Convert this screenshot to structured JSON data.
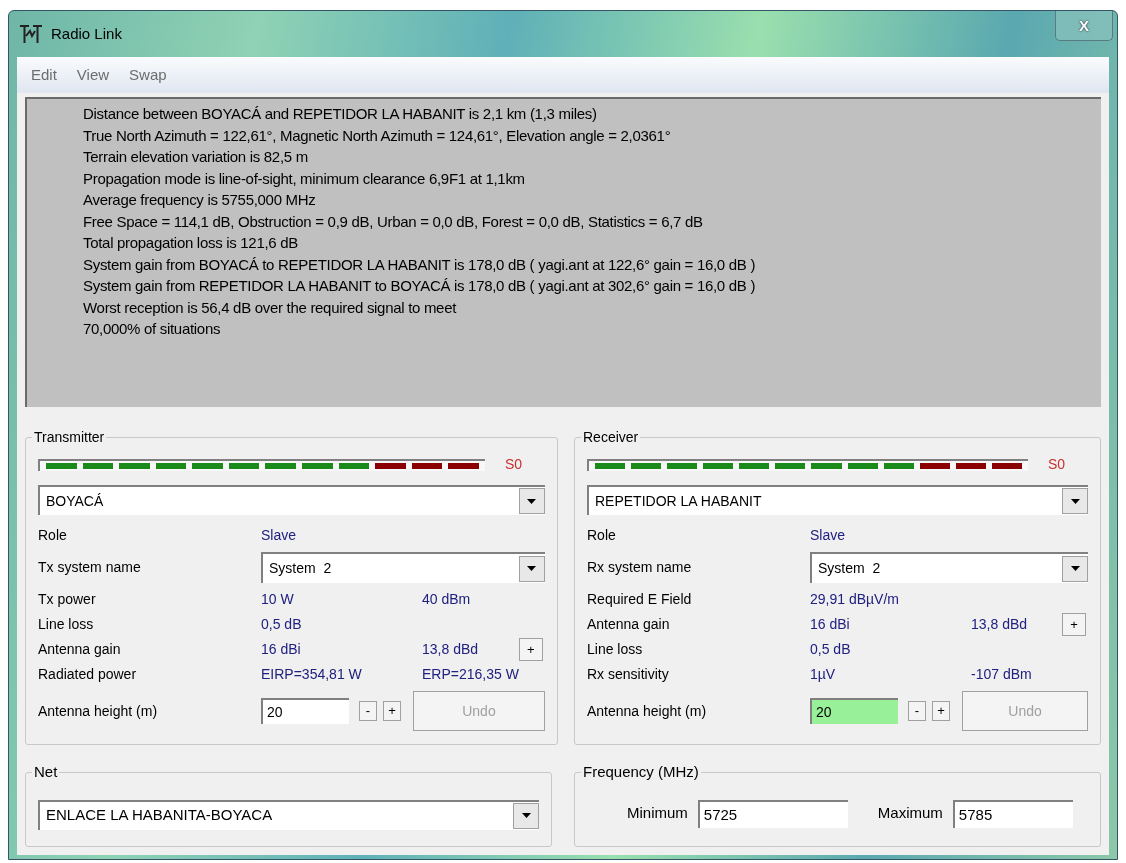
{
  "window": {
    "title": "Radio Link",
    "close": "X"
  },
  "menu": [
    {
      "label": "Edit"
    },
    {
      "label": "View"
    },
    {
      "label": "Swap"
    }
  ],
  "report": [
    "Distance between BOYACÁ and REPETIDOR LA HABANIT is 2,1 km (1,3 miles)",
    "True North Azimuth = 122,61°, Magnetic North Azimuth = 124,61°, Elevation angle = 2,0361°",
    "Terrain elevation variation is 82,5 m",
    "Propagation mode is line-of-sight, minimum clearance 6,9F1 at 1,1km",
    "Average frequency is 5755,000 MHz",
    "Free Space = 114,1 dB, Obstruction = 0,9 dB, Urban = 0,0 dB, Forest = 0,0 dB, Statistics = 6,7 dB",
    "Total propagation loss is 121,6 dB",
    "System gain from BOYACÁ to REPETIDOR LA HABANIT is 178,0 dB ( yagi.ant at 122,6° gain = 16,0 dB )",
    "System gain from REPETIDOR LA HABANIT to BOYACÁ is 178,0 dB ( yagi.ant at 302,6° gain = 16,0 dB )",
    "Worst reception is 56,4 dB over the required signal to meet",
    "70,000% of situations"
  ],
  "stations": [
    {
      "title": "Transmitter",
      "meter_label": "S0",
      "site": "BOYACÁ",
      "rows": [
        {
          "kind": "text",
          "label": "Role",
          "values": [
            "Slave"
          ]
        },
        {
          "kind": "select",
          "label": "Tx system name",
          "value": "System  2"
        },
        {
          "kind": "text",
          "label": "Tx power",
          "values": [
            "10 W",
            "40 dBm"
          ]
        },
        {
          "kind": "text",
          "label": "Line loss",
          "values": [
            "0,5 dB"
          ]
        },
        {
          "kind": "text",
          "label": "Antenna gain",
          "values": [
            "16 dBi",
            "13,8 dBd"
          ],
          "button": "+"
        },
        {
          "kind": "text",
          "label": "Radiated power",
          "values": [
            "EIRP=354,81 W",
            "ERP=216,35 W"
          ]
        }
      ],
      "height": {
        "label": "Antenna height (m)",
        "value": "20",
        "highlighted": false,
        "minus": "-",
        "plus": "+",
        "undo": "Undo",
        "undo_disabled": true
      }
    },
    {
      "title": "Receiver",
      "meter_label": "S0",
      "site": "REPETIDOR LA HABANIT",
      "rows": [
        {
          "kind": "text",
          "label": "Role",
          "values": [
            "Slave"
          ]
        },
        {
          "kind": "select",
          "label": "Rx system name",
          "value": "System  2"
        },
        {
          "kind": "text",
          "label": "Required E Field",
          "values": [
            "29,91 dBµV/m"
          ]
        },
        {
          "kind": "text",
          "label": "Antenna gain",
          "values": [
            "16 dBi",
            "13,8 dBd"
          ],
          "button": "+"
        },
        {
          "kind": "text",
          "label": "Line loss",
          "values": [
            "0,5 dB"
          ]
        },
        {
          "kind": "text",
          "label": "Rx sensitivity",
          "values": [
            "1µV",
            "-107 dBm"
          ]
        }
      ],
      "height": {
        "label": "Antenna height (m)",
        "value": "20",
        "highlighted": true,
        "minus": "-",
        "plus": "+",
        "undo": "Undo",
        "undo_disabled": true
      }
    }
  ],
  "net": {
    "title": "Net",
    "value": "ENLACE LA HABANITA-BOYACA"
  },
  "frequency": {
    "title": "Frequency (MHz)",
    "minimum_label": "Minimum",
    "minimum": "5725",
    "maximum_label": "Maximum",
    "maximum": "5785"
  }
}
